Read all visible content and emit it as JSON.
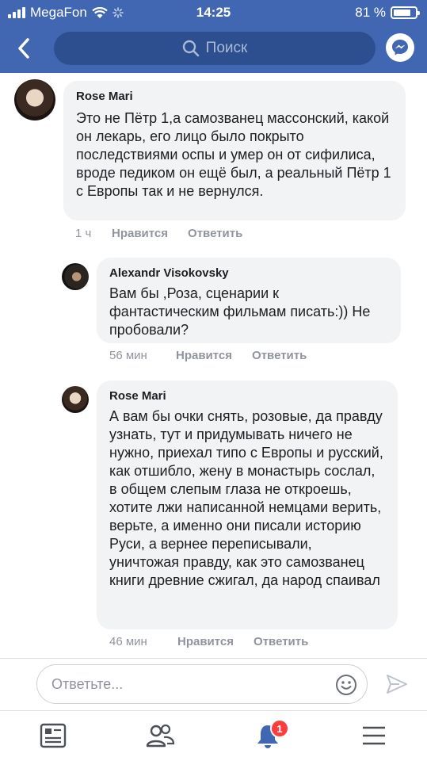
{
  "status_bar": {
    "carrier": "MegaFon",
    "time": "14:25",
    "battery_percent": "81 %",
    "battery_level": 0.81
  },
  "header": {
    "search_placeholder": "Поиск",
    "back_icon": "chevron-left-icon",
    "messenger_icon": "messenger-icon",
    "accent_color": "#4267b2"
  },
  "comments": [
    {
      "author": "Rose Mari",
      "text": "Это не Пётр 1,а самозванец массонский, какой он лекарь, его лицо было покрыто последствиями оспы и умер он от сифилиса, вроде педиком он ещё был, а реальный Пётр 1 с Европы так и не вернулся.",
      "time": "1 ч",
      "like": "Нравится",
      "reply": "Ответить"
    },
    {
      "author": "Alexandr Visokovsky",
      "text": "Вам бы ,Роза, сценарии к фантастическим фильмам писать:)) Не пробовали?",
      "time": "56 мин",
      "like": "Нравится",
      "reply": "Ответить"
    },
    {
      "author": "Rose Mari",
      "text": "А вам бы очки снять, розовые, да правду узнать, тут и придумывать ничего не нужно, приехал типо с Европы и русский, как отшибло, жену в монастырь сослал, в общем слепым глаза не откроешь, хотите лжи написанной немцами верить, верьте, а именно они писали историю Руси, а вернее переписывали, уничтожая правду, как это самозванец книги древние сжигал, да народ спаивал",
      "time": "46 мин",
      "like": "Нравится",
      "reply": "Ответить"
    }
  ],
  "composer": {
    "placeholder": "Ответьте...",
    "emoji_icon": "emoji-icon",
    "send_icon": "send-icon"
  },
  "tab_bar": {
    "tabs": [
      "news-feed-icon",
      "friends-icon",
      "notifications-icon",
      "menu-icon"
    ],
    "notifications_badge": "1",
    "badge_color": "#fa3e3e"
  }
}
